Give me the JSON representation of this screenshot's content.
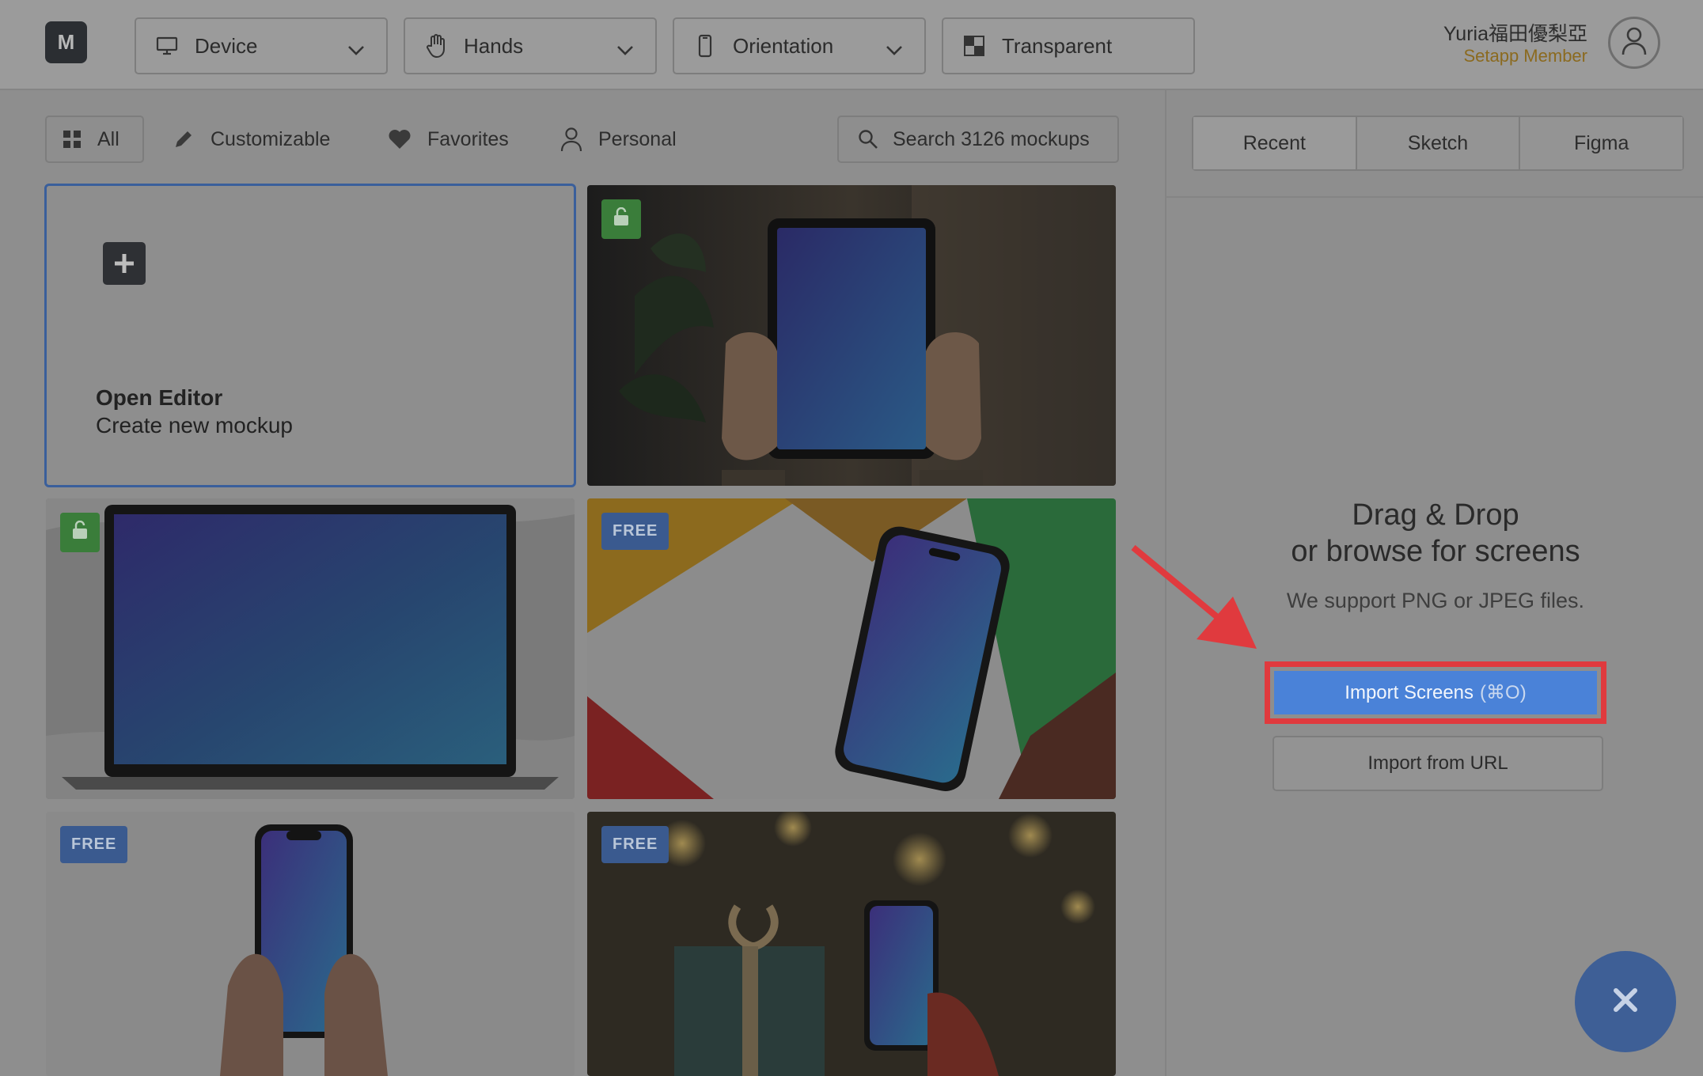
{
  "app": {
    "logo": "M"
  },
  "toolbar": {
    "device": "Device",
    "hands": "Hands",
    "orientation": "Orientation",
    "background": "Transparent"
  },
  "user": {
    "name": "Yuria福田優梨亞",
    "plan": "Setapp Member"
  },
  "filters": {
    "all": "All",
    "customizable": "Customizable",
    "favorites": "Favorites",
    "personal": "Personal",
    "search_label": "Search 3126 mockups"
  },
  "editor_card": {
    "title": "Open Editor",
    "subtitle": "Create new mockup"
  },
  "mockups": [
    {
      "badge": "lock",
      "device": "tablet"
    },
    {
      "badge": "lock",
      "device": "laptop"
    },
    {
      "badge": "FREE",
      "device": "phone"
    },
    {
      "badge": "FREE",
      "device": "phone"
    },
    {
      "badge": "FREE",
      "device": "phone"
    }
  ],
  "panel": {
    "tabs": [
      "Recent",
      "Sketch",
      "Figma"
    ],
    "drop_title_1": "Drag & Drop",
    "drop_title_2": "or browse for screens",
    "support": "We support PNG or JPEG files.",
    "import_label": "Import Screens",
    "import_shortcut": "(⌘O)",
    "import_url": "Import from URL"
  },
  "colors": {
    "accent": "#4a82d8",
    "highlight": "#e03a3e",
    "free_badge": "#3a5a8f",
    "lock_badge": "#3a7d3a"
  }
}
